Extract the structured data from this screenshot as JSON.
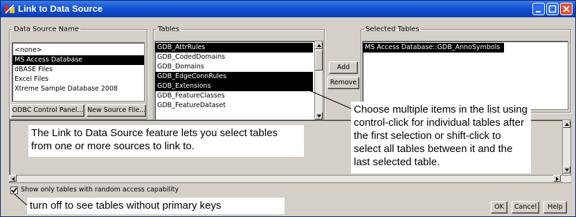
{
  "window": {
    "title": "Link to Data Source"
  },
  "data_source": {
    "legend": "Data Source Name",
    "items": [
      {
        "label": "<none>",
        "selected": false
      },
      {
        "label": "MS Access Database",
        "selected": true
      },
      {
        "label": "dBASE Files",
        "selected": false
      },
      {
        "label": "Excel Files",
        "selected": false
      },
      {
        "label": "Xtreme Sample Database 2008",
        "selected": false
      }
    ],
    "odbc_button": "ODBC Control Panel...",
    "new_source_button": "New Source File..."
  },
  "tables": {
    "legend": "Tables",
    "items": [
      {
        "label": "GDB_AttrRules",
        "selected": true
      },
      {
        "label": "GDB_CodedDomains",
        "selected": false
      },
      {
        "label": "GDB_Domains",
        "selected": false
      },
      {
        "label": "GDB_EdgeConnRules",
        "selected": true
      },
      {
        "label": "GDB_Extensions",
        "selected": true
      },
      {
        "label": "GDB_FeatureClasses",
        "selected": false
      },
      {
        "label": "GDB_FeatureDataset",
        "selected": false
      }
    ]
  },
  "actions": {
    "add": "Add",
    "remove": "Remove"
  },
  "selected_tables": {
    "legend": "Selected Tables",
    "items": [
      "MS Access Database::GDB_AnnoSymbols"
    ]
  },
  "checkbox": {
    "label": "Show only tables with random access capability",
    "checked": true
  },
  "buttons": {
    "ok": "OK",
    "cancel": "Cancel",
    "help": "Help"
  },
  "callouts": {
    "link_feature": "The Link to Data Source feature lets you select tables from one or more sources to link to.",
    "multiple_items": "Choose multiple items in the list using control-click for individual tables after the first selection or shift-click to select all tables between it and the last selected table.",
    "turn_off": "turn off to see tables without primary keys"
  },
  "colors": {
    "titlebar": "#1552d6",
    "dialog_face": "#d4d0c8",
    "selection": "#000000"
  }
}
